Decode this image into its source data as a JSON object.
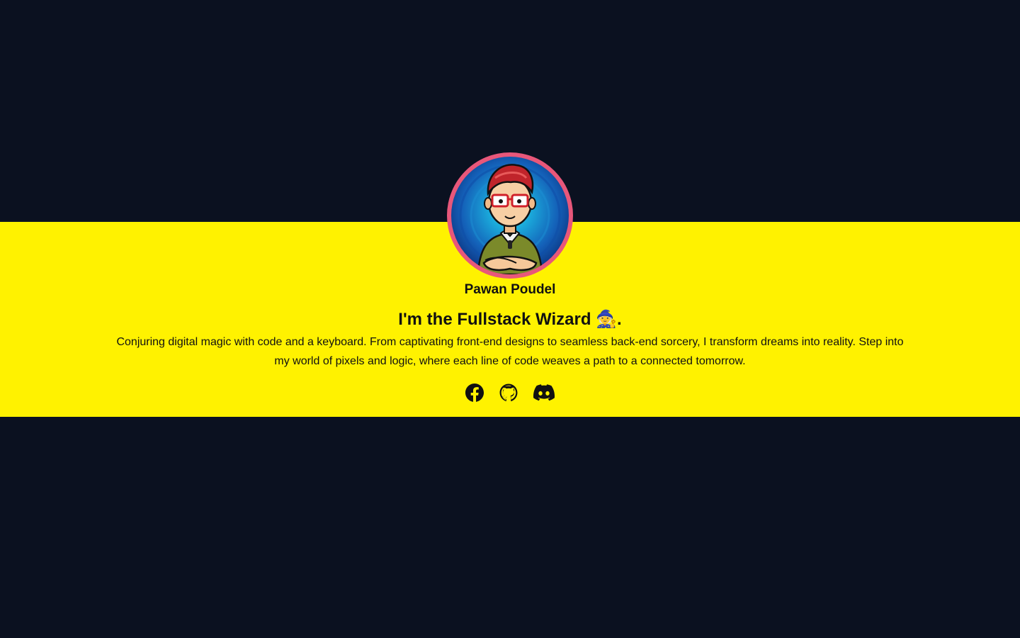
{
  "profile": {
    "name": "Pawan Poudel",
    "headline": "I'm the Fullstack Wizard 🧙.",
    "bio": "Conjuring digital magic with code and a keyboard. From captivating front-end designs to seamless back-end sorcery, I transform dreams into reality. Step into my world of pixels and logic, where each line of code weaves a path to a connected tomorrow."
  },
  "socials": [
    {
      "icon": "facebook-icon"
    },
    {
      "icon": "github-icon"
    },
    {
      "icon": "discord-icon"
    }
  ],
  "colors": {
    "background": "#0b1120",
    "band": "#fff200",
    "avatar_ring": "#e8577a",
    "text": "#111111"
  }
}
